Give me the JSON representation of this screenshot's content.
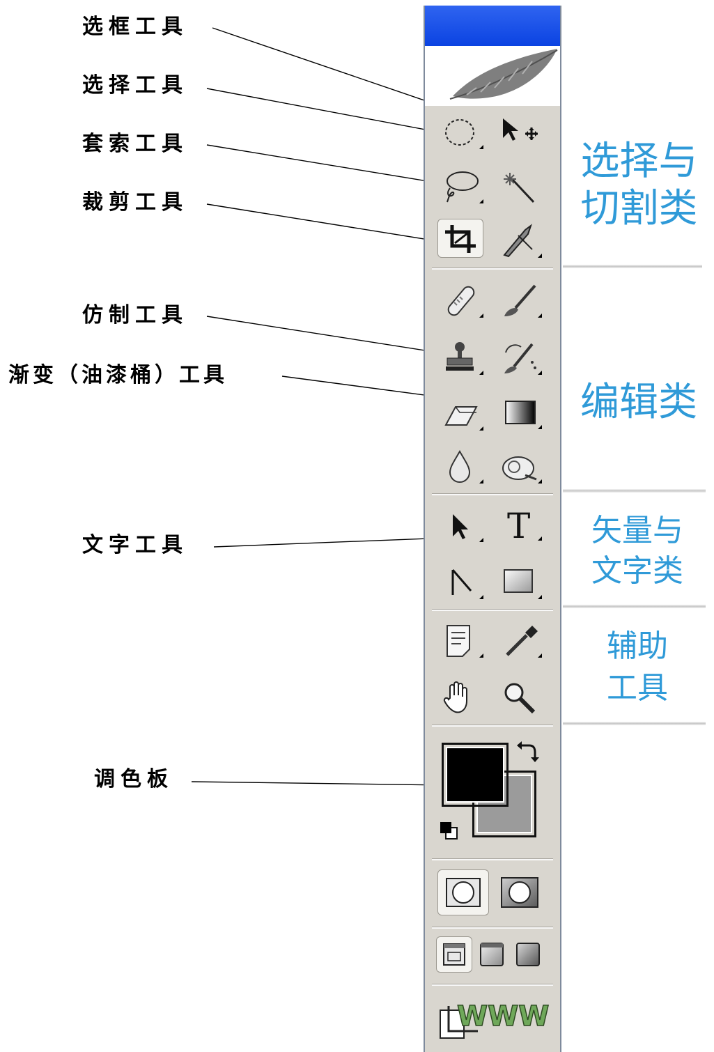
{
  "callouts": {
    "marquee": "选框工具",
    "selection": "选择工具",
    "lasso": "套索工具",
    "crop": "裁剪工具",
    "clone": "仿制工具",
    "gradient": "渐变（油漆桶）工具",
    "text": "文字工具",
    "palette": "调色板"
  },
  "categories": {
    "select_crop": {
      "line1": "选择与",
      "line2": "切割类"
    },
    "edit": {
      "line1": "编辑类"
    },
    "vector_text": {
      "line1": "矢量与",
      "line2": "文字类"
    },
    "aux": {
      "line1": "辅助",
      "line2": "工具"
    }
  },
  "toolbox": {
    "icons": [
      "feather-icon",
      "marquee-icon",
      "move-icon",
      "lasso-icon",
      "magic-wand-icon",
      "crop-icon",
      "slice-icon",
      "healing-brush-icon",
      "brush-icon",
      "clone-stamp-icon",
      "history-brush-icon",
      "eraser-icon",
      "gradient-icon",
      "blur-icon",
      "dodge-icon",
      "path-selection-icon",
      "type-icon",
      "pen-icon",
      "rectangle-shape-icon",
      "notes-icon",
      "eyedropper-icon",
      "hand-icon",
      "zoom-icon",
      "swap-colors-icon",
      "default-colors-icon",
      "standard-mode-icon",
      "quick-mask-icon",
      "screen-mode-standard-icon",
      "screen-mode-full-menu-icon",
      "screen-mode-full-icon",
      "jump-to-imageready-icon"
    ],
    "foreground_color": "#000000",
    "background_color": "#9b9b9b",
    "title_bar_color": "#1f55ea",
    "bottom_logo_text": "WWW"
  },
  "colors": {
    "callout_text": "#000000",
    "category_text": "#2f9ad8"
  }
}
